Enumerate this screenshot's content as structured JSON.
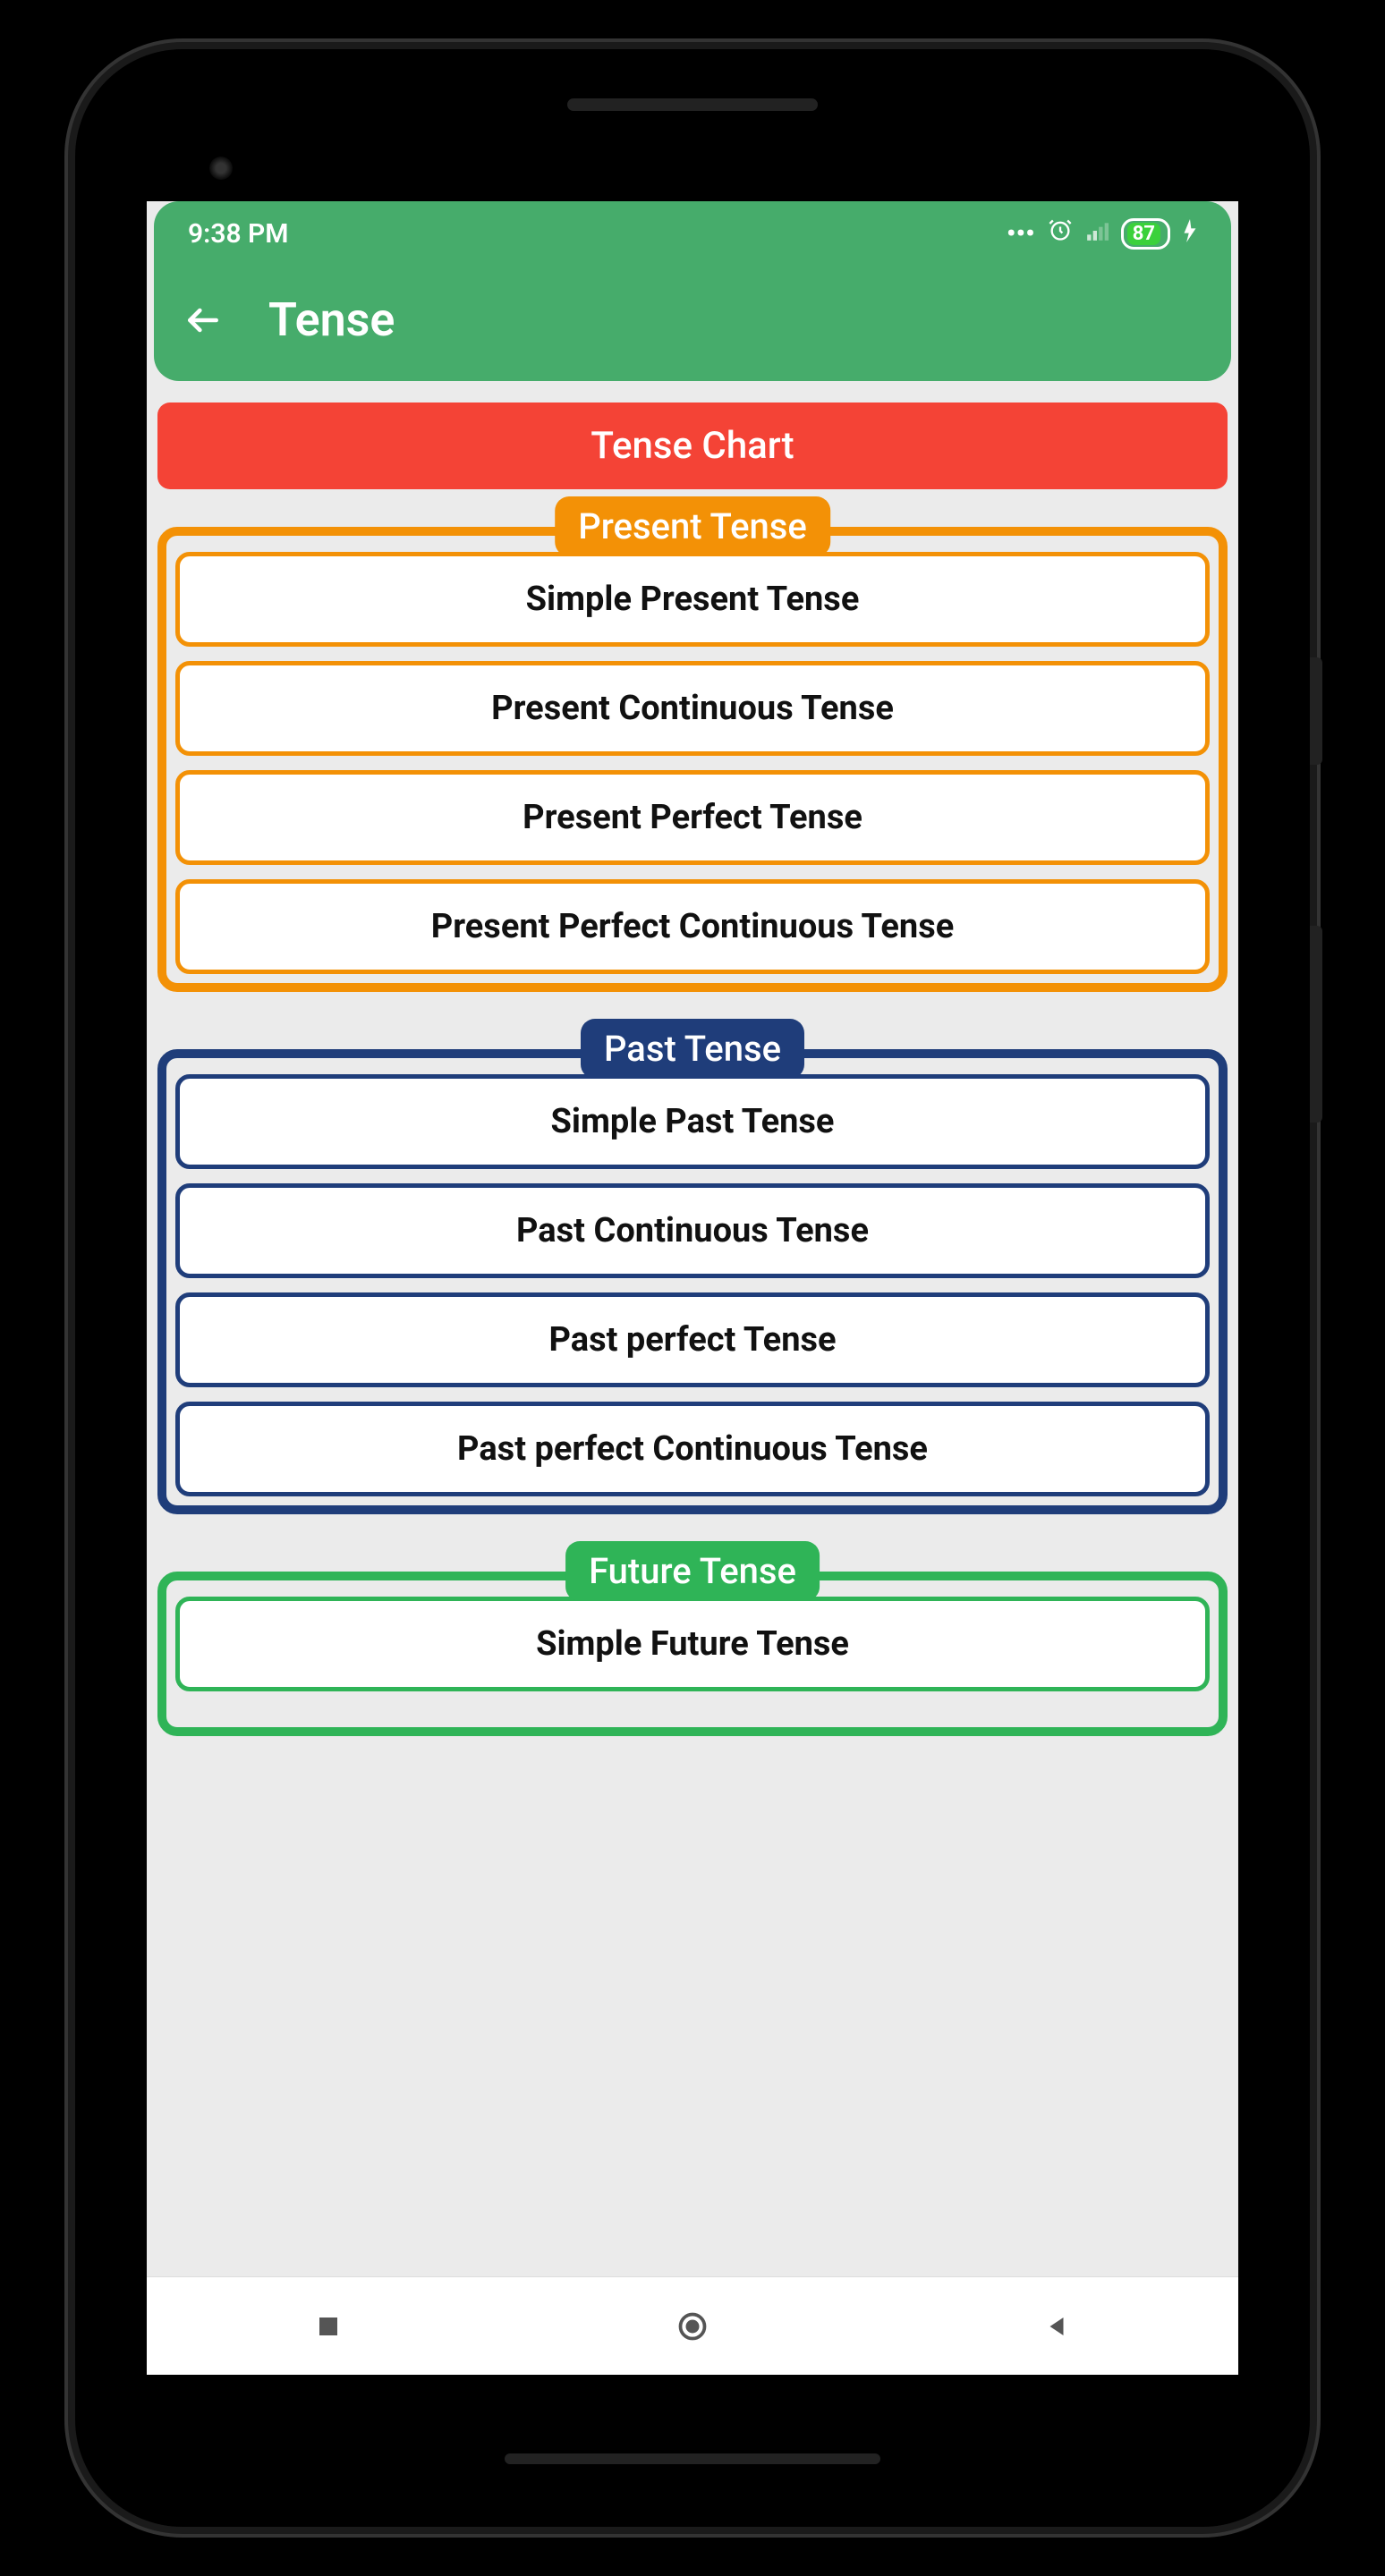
{
  "status": {
    "time": "9:38 PM",
    "battery": "87"
  },
  "appbar": {
    "title": "Tense"
  },
  "chart_header": "Tense Chart",
  "groups": {
    "present": {
      "label": "Present Tense",
      "items": [
        "Simple Present Tense",
        "Present Continuous Tense",
        "Present Perfect Tense",
        "Present Perfect Continuous Tense"
      ]
    },
    "past": {
      "label": "Past Tense",
      "items": [
        "Simple Past Tense",
        "Past Continuous Tense",
        "Past perfect Tense",
        "Past perfect Continuous Tense"
      ]
    },
    "future": {
      "label": "Future Tense",
      "items": [
        "Simple Future Tense"
      ]
    }
  }
}
